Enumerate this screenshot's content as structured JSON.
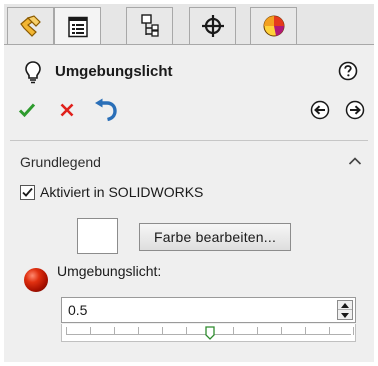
{
  "tabs": [
    {
      "icon": "feature-manager-icon"
    },
    {
      "icon": "property-manager-icon"
    },
    {
      "icon": "configuration-manager-icon"
    },
    {
      "icon": "dimxpert-manager-icon"
    },
    {
      "icon": "display-manager-icon"
    }
  ],
  "active_tab": 1,
  "title": "Umgebungslicht",
  "section": {
    "title": "Grundlegend",
    "checkbox_label": "Aktiviert in SOLIDWORKS",
    "checkbox_checked": true,
    "swatch_color": "#ffffff",
    "edit_color_label": "Farbe bearbeiten...",
    "ambient_label": "Umgebungslicht:",
    "ambient_value": "0.5",
    "slider_fraction": 0.5
  },
  "colors": {
    "accept": "#2e9b2e",
    "cancel": "#e0201b",
    "nav": "#2a6fb8"
  }
}
